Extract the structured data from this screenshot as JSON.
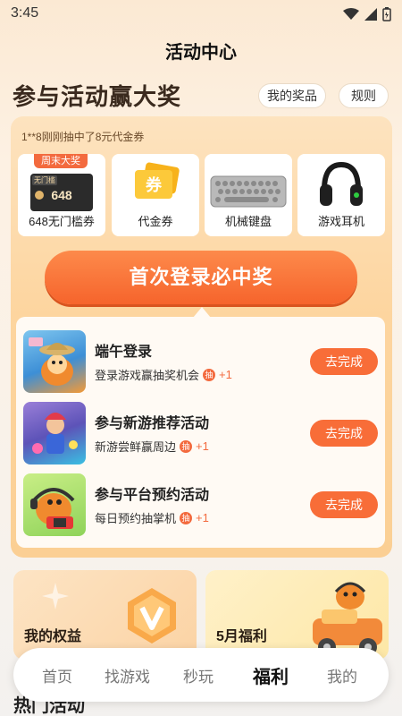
{
  "status_bar": {
    "time": "3:45"
  },
  "page_title": "活动中心",
  "headline": "参与活动赢大奖",
  "buttons": {
    "my_prizes": "我的奖品",
    "rules": "规则"
  },
  "ticker": "1**8刚刚抽中了8元代金券",
  "prizes": [
    {
      "label": "648无门槛券",
      "tag": "周末大奖",
      "ticket_tag": "无门槛",
      "ticket_value": "648"
    },
    {
      "label": "代金券",
      "icon_text": "券"
    },
    {
      "label": "机械键盘"
    },
    {
      "label": "游戏耳机"
    }
  ],
  "cta": "首次登录必中奖",
  "tasks": [
    {
      "title": "端午登录",
      "subtitle": "登录游戏赢抽奖机会",
      "badge": "抽",
      "reward": "+1",
      "button": "去完成"
    },
    {
      "title": "参与新游推荐活动",
      "subtitle": "新游尝鲜赢周边",
      "badge": "抽",
      "reward": "+1",
      "button": "去完成"
    },
    {
      "title": "参与平台预约活动",
      "subtitle": "每日预约抽掌机",
      "badge": "抽",
      "reward": "+1",
      "button": "去完成"
    }
  ],
  "perks": {
    "rights": "我的权益",
    "may": "5月福利"
  },
  "hot_section": "热门活动",
  "tabbar": {
    "tabs": [
      "首页",
      "找游戏",
      "秒玩",
      "福利",
      "我的"
    ],
    "active": "福利"
  },
  "colors": {
    "accent": "#f86d38",
    "panel": "#fdd59f",
    "tag": "#f36a3e"
  }
}
